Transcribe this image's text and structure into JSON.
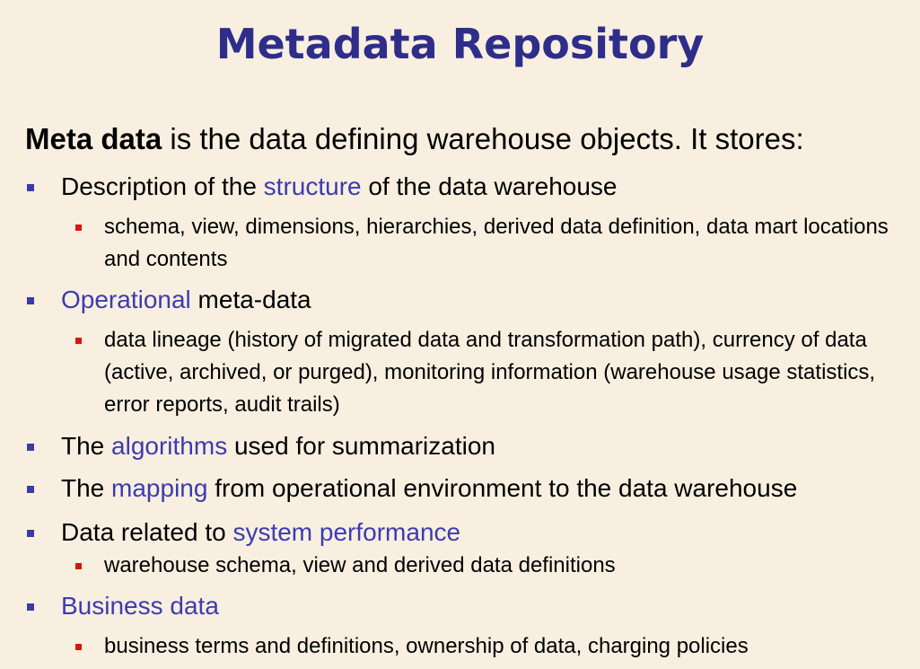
{
  "title": "Metadata Repository",
  "intro": {
    "term": "Meta data",
    "rest": " is the data defining warehouse objects.  It stores:"
  },
  "items": [
    {
      "pre": "Description of the ",
      "highlight": "structure",
      "post": " of the data warehouse",
      "sub": "schema, view, dimensions, hierarchies, derived data definition, data mart locations and contents"
    },
    {
      "pre": "",
      "highlight": "Operational",
      "post": " meta-data",
      "sub": "data lineage (history of migrated data and transformation path), currency of data (active, archived, or purged), monitoring information (warehouse usage statistics, error reports, audit trails)"
    },
    {
      "pre": "The ",
      "highlight": "algorithms",
      "post": " used for summarization"
    },
    {
      "pre": "The ",
      "highlight": "mapping",
      "post": " from operational environment to the data warehouse"
    },
    {
      "pre": "Data related to ",
      "highlight": "system performance",
      "post": "",
      "sub": "warehouse schema, view and derived data definitions"
    },
    {
      "pre": "",
      "highlight": "Business data",
      "post": "",
      "sub": "business terms and definitions, ownership of data, charging policies"
    }
  ],
  "colors": {
    "background": "#f8efe0",
    "title": "#2e2e8a",
    "highlight": "#3c3cb0",
    "level1_bullet": "#3a3aa8",
    "level2_bullet": "#e01010"
  }
}
